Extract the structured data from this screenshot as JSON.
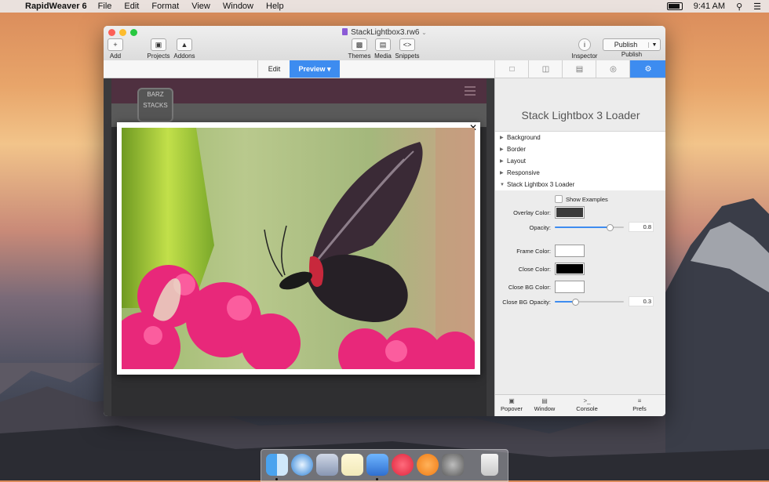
{
  "menubar": {
    "app_name": "RapidWeaver 6",
    "menus": [
      "File",
      "Edit",
      "Format",
      "View",
      "Window",
      "Help"
    ],
    "clock": "9:41 AM"
  },
  "window": {
    "title": "StackLightbox3.rw6",
    "toolbar": {
      "add": "Add",
      "projects": "Projects",
      "addons": "Addons",
      "themes": "Themes",
      "media": "Media",
      "snippets": "Snippets",
      "inspector": "Inspector",
      "publish": "Publish",
      "publish_button": "Publish"
    },
    "modes": {
      "edit": "Edit",
      "preview": "Preview ▾"
    }
  },
  "lightbox": {
    "close_glyph": "✕"
  },
  "site": {
    "logo_text": "BARZ STACKS"
  },
  "inspector": {
    "header": "Stack Lightbox 3 Loader",
    "sections": [
      {
        "label": "Background",
        "tri": "▶"
      },
      {
        "label": "Border",
        "tri": "▶"
      },
      {
        "label": "Layout",
        "tri": "▶"
      },
      {
        "label": "Responsive",
        "tri": "▶"
      },
      {
        "label": "Stack Lightbox 3 Loader",
        "tri": "▼"
      }
    ],
    "show_examples": "Show Examples",
    "props": {
      "overlay_color": {
        "label": "Overlay Color:",
        "color": "#3b3b3b"
      },
      "opacity": {
        "label": "Opacity:",
        "value": "0.8",
        "level": 0.8
      },
      "frame_color": {
        "label": "Frame Color:",
        "color": "#ffffff"
      },
      "close_color": {
        "label": "Close Color:",
        "color": "#000000"
      },
      "close_bg_color": {
        "label": "Close BG Color:",
        "color": "#ffffff"
      },
      "close_bg_opacity": {
        "label": "Close BG Opacity:",
        "value": "0.3",
        "level": 0.3
      }
    },
    "footer": [
      "Popover",
      "Window",
      "Console",
      "Prefs"
    ]
  },
  "colors": {
    "accent": "#3d8cf0"
  }
}
